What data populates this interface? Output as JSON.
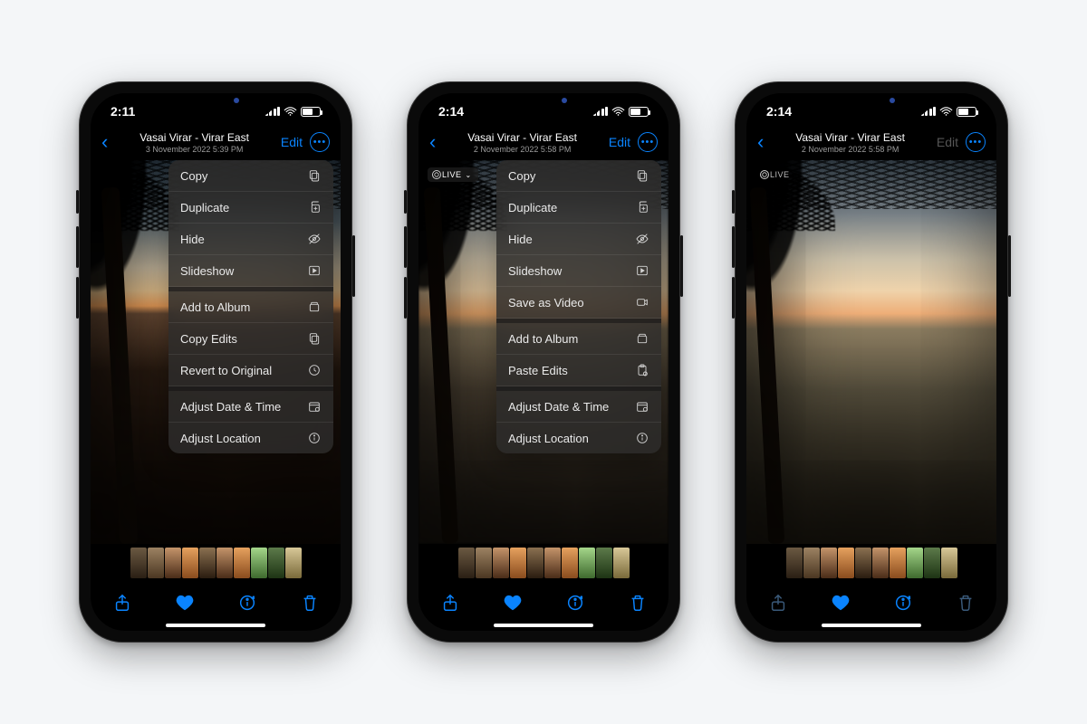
{
  "phones": [
    {
      "status_time": "2:11",
      "header_title": "Vasai Virar - Virar East",
      "header_subtitle": "3 November 2022 5:39 PM",
      "edit_label": "Edit",
      "edit_disabled": false,
      "show_live": false,
      "live_label": "LIVE",
      "show_chevron": false,
      "photo_class": "sky1",
      "show_menu": true,
      "menu": [
        {
          "label": "Copy",
          "icon": "copy",
          "sep": false
        },
        {
          "label": "Duplicate",
          "icon": "duplicate",
          "sep": false
        },
        {
          "label": "Hide",
          "icon": "hide",
          "sep": false
        },
        {
          "label": "Slideshow",
          "icon": "play",
          "sep": true
        },
        {
          "label": "Add to Album",
          "icon": "album",
          "sep": false
        },
        {
          "label": "Copy Edits",
          "icon": "copy",
          "sep": false
        },
        {
          "label": "Revert to Original",
          "icon": "revert",
          "sep": true
        },
        {
          "label": "Adjust Date & Time",
          "icon": "cal",
          "sep": false
        },
        {
          "label": "Adjust Location",
          "icon": "info",
          "sep": false
        }
      ],
      "toolbar_dim": false
    },
    {
      "status_time": "2:14",
      "header_title": "Vasai Virar - Virar East",
      "header_subtitle": "2 November 2022 5:58 PM",
      "edit_label": "Edit",
      "edit_disabled": false,
      "show_live": true,
      "live_label": "LIVE",
      "show_chevron": true,
      "photo_class": "sky2",
      "show_menu": true,
      "menu": [
        {
          "label": "Copy",
          "icon": "copy",
          "sep": false
        },
        {
          "label": "Duplicate",
          "icon": "duplicate",
          "sep": false
        },
        {
          "label": "Hide",
          "icon": "hide",
          "sep": false
        },
        {
          "label": "Slideshow",
          "icon": "play",
          "sep": false
        },
        {
          "label": "Save as Video",
          "icon": "video",
          "sep": true
        },
        {
          "label": "Add to Album",
          "icon": "album",
          "sep": false
        },
        {
          "label": "Paste Edits",
          "icon": "paste",
          "sep": true
        },
        {
          "label": "Adjust Date & Time",
          "icon": "cal",
          "sep": false
        },
        {
          "label": "Adjust Location",
          "icon": "info",
          "sep": false
        }
      ],
      "toolbar_dim": false
    },
    {
      "status_time": "2:14",
      "header_title": "Vasai Virar - Virar East",
      "header_subtitle": "2 November 2022 5:58 PM",
      "edit_label": "Edit",
      "edit_disabled": true,
      "show_live": true,
      "live_label": "LIVE",
      "show_chevron": false,
      "photo_class": "sky3",
      "show_menu": false,
      "menu": [],
      "toolbar_dim": true
    }
  ],
  "thumb_classes": [
    "th-a",
    "th-b",
    "th-c",
    "th-d",
    "th-h",
    "th-c",
    "th-d",
    "th-e",
    "th-f",
    "th-g"
  ],
  "accent": "#0a84ff"
}
